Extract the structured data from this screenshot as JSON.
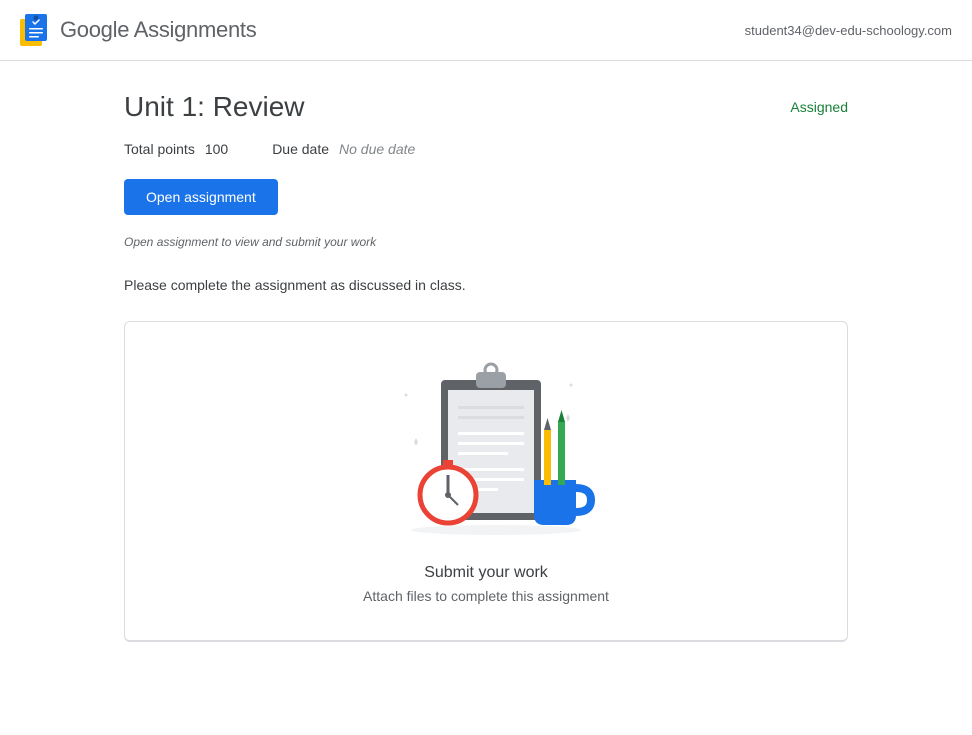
{
  "header": {
    "product_bold": "Google",
    "product_light": " Assignments",
    "user_email": "student34@dev-edu-schoology.com"
  },
  "assignment": {
    "title": "Unit 1: Review",
    "status": "Assigned",
    "points_label": "Total points",
    "points_value": "100",
    "due_label": "Due date",
    "due_value": "No due date",
    "open_button": "Open assignment",
    "helper": "Open assignment to view and submit your work",
    "description": "Please complete the assignment as discussed in class."
  },
  "card": {
    "title": "Submit your work",
    "subtitle": "Attach files to complete this assignment"
  }
}
